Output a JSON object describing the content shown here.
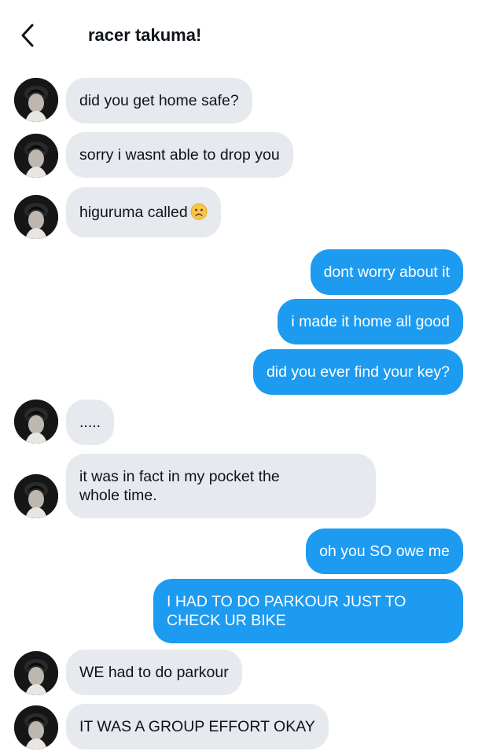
{
  "header": {
    "title": "racer takuma!"
  },
  "icons": {
    "back": "chevron-left-icon",
    "emoji": "slightly-frowning-face-emoji"
  },
  "colors": {
    "incoming_bubble": "#e6e9ed",
    "outgoing_bubble": "#1d9bf0"
  },
  "messages": [
    {
      "from": "them",
      "text": "did you get home safe?"
    },
    {
      "from": "them",
      "text": "sorry i wasnt able to drop you"
    },
    {
      "from": "them",
      "text": "higuruma called"
    },
    {
      "from": "me",
      "text": "dont worry about it"
    },
    {
      "from": "me",
      "text": "i made it home all good"
    },
    {
      "from": "me",
      "text": "did you ever find your key?"
    },
    {
      "from": "them",
      "text": "....."
    },
    {
      "from": "them",
      "text": "it was in fact in my pocket the\nwhole time."
    },
    {
      "from": "me",
      "text": "oh you SO owe me"
    },
    {
      "from": "me",
      "text": "I HAD TO DO PARKOUR JUST TO\nCHECK UR BIKE"
    },
    {
      "from": "them",
      "text": "WE had to do parkour"
    },
    {
      "from": "them",
      "text": "IT WAS A GROUP EFFORT OKAY"
    }
  ]
}
